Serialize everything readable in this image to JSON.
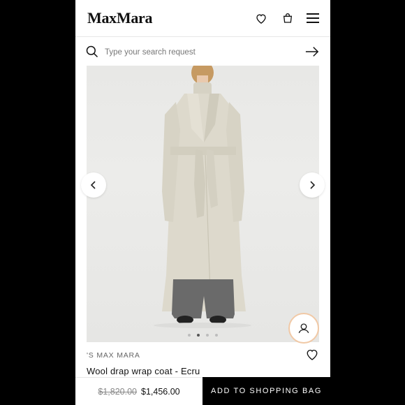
{
  "header": {
    "logo": "MaxMara",
    "icons": [
      "heart-icon",
      "bag-icon",
      "menu-icon"
    ]
  },
  "search": {
    "placeholder": "Type your search request",
    "value": ""
  },
  "gallery": {
    "image_alt": "Model wearing ecru wool wrap coat",
    "slide_count": 4,
    "active_slide": 2
  },
  "product": {
    "brand": "'S MAX MARA",
    "title": "Wool drap wrap coat - Ecru",
    "old_price": "$1,820.00",
    "new_price": "$1,456.00",
    "add_to_bag_label": "ADD TO SHOPPING BAG"
  },
  "colors": {
    "accent_black": "#000000",
    "coat": "#ddd9cc",
    "assist_ring": "#f1c9a6"
  }
}
